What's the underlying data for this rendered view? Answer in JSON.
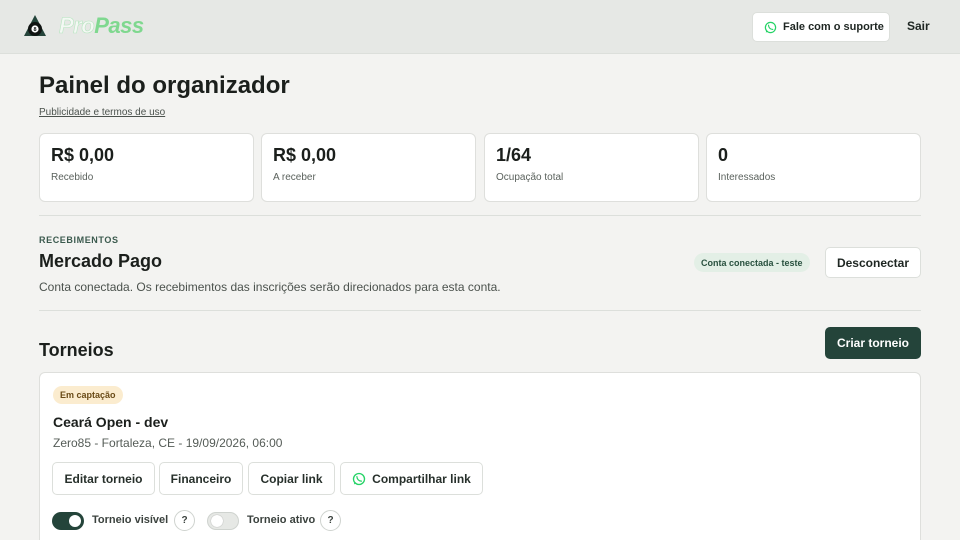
{
  "app": {
    "brand_pro": "Pro",
    "brand_pass": "Pass"
  },
  "header": {
    "support_label": "Fale com o suporte",
    "logout_label": "Sair"
  },
  "page": {
    "title": "Painel do organizador",
    "terms_link": "Publicidade e termos de uso"
  },
  "stats": [
    {
      "value": "R$ 0,00",
      "label": "Recebido"
    },
    {
      "value": "R$ 0,00",
      "label": "A receber"
    },
    {
      "value": "1/64",
      "label": "Ocupação total"
    },
    {
      "value": "0",
      "label": "Interessados"
    }
  ],
  "payments": {
    "kicker": "RECEBIMENTOS",
    "provider": "Mercado Pago",
    "description": "Conta conectada. Os recebimentos das inscrições serão direcionados para esta conta.",
    "status_badge": "Conta conectada - teste",
    "disconnect_label": "Desconectar"
  },
  "tournaments": {
    "title": "Torneios",
    "create_label": "Criar torneio",
    "items": [
      {
        "status": "Em captação",
        "name": "Ceará Open - dev",
        "meta": "Zero85 - Fortaleza, CE - 19/09/2026, 06:00",
        "actions": {
          "edit": "Editar torneio",
          "finance": "Financeiro",
          "copy_link": "Copiar link",
          "share_link": "Compartilhar link"
        },
        "toggles": {
          "visible_label": "Torneio visível",
          "visible_on": true,
          "active_label": "Torneio ativo",
          "active_on": false,
          "help": "?"
        }
      }
    ]
  },
  "colors": {
    "primary": "#24443a",
    "brand_green": "#7fd88f",
    "whatsapp": "#25d366",
    "badge_pending_bg": "#fbeccf",
    "badge_connected_bg": "#e3efe6"
  },
  "icons": {
    "logo": "billiard-8-ball-icon",
    "support": "whatsapp-icon",
    "share": "whatsapp-icon"
  }
}
